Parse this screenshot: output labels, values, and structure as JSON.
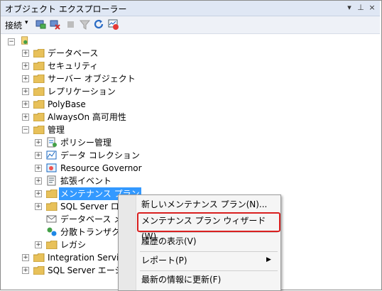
{
  "window": {
    "title": "オブジェクト エクスプローラー",
    "pin": "⊥",
    "close": "×",
    "dropdown": "▾"
  },
  "toolbar": {
    "connect_label": "接続",
    "connect_arrow": "▾"
  },
  "tree": {
    "databases": "データベース",
    "security": "セキュリティ",
    "server_objects": "サーバー オブジェクト",
    "replication": "レプリケーション",
    "polybase": "PolyBase",
    "alwayson": "AlwaysOn 高可用性",
    "management": "管理",
    "policy_management": "ポリシー管理",
    "data_collection": "データ コレクション",
    "resource_governor": "Resource Governor",
    "extended_events": "拡張イベント",
    "maintenance_plans": "メンテナンス プラン",
    "sql_server_logs": "SQL Server ロ",
    "db_mail": "データベース メー",
    "dtc": "分散トランザクショ",
    "legacy": "レガシ",
    "integration_services": "Integration Servi",
    "sql_server_agent": "SQL Server エージ"
  },
  "context_menu": {
    "new_plan": "新しいメンテナンス プラン(N)...",
    "wizard": "メンテナンス プラン ウィザード(W)",
    "history": "履歴の表示(V)",
    "reports": "レポート(P)",
    "refresh": "最新の情報に更新(F)",
    "submenu_arrow": "▶"
  },
  "colors": {
    "folder": "#e8c15a",
    "selected": "#3399ff",
    "highlight_border": "#d92020"
  }
}
